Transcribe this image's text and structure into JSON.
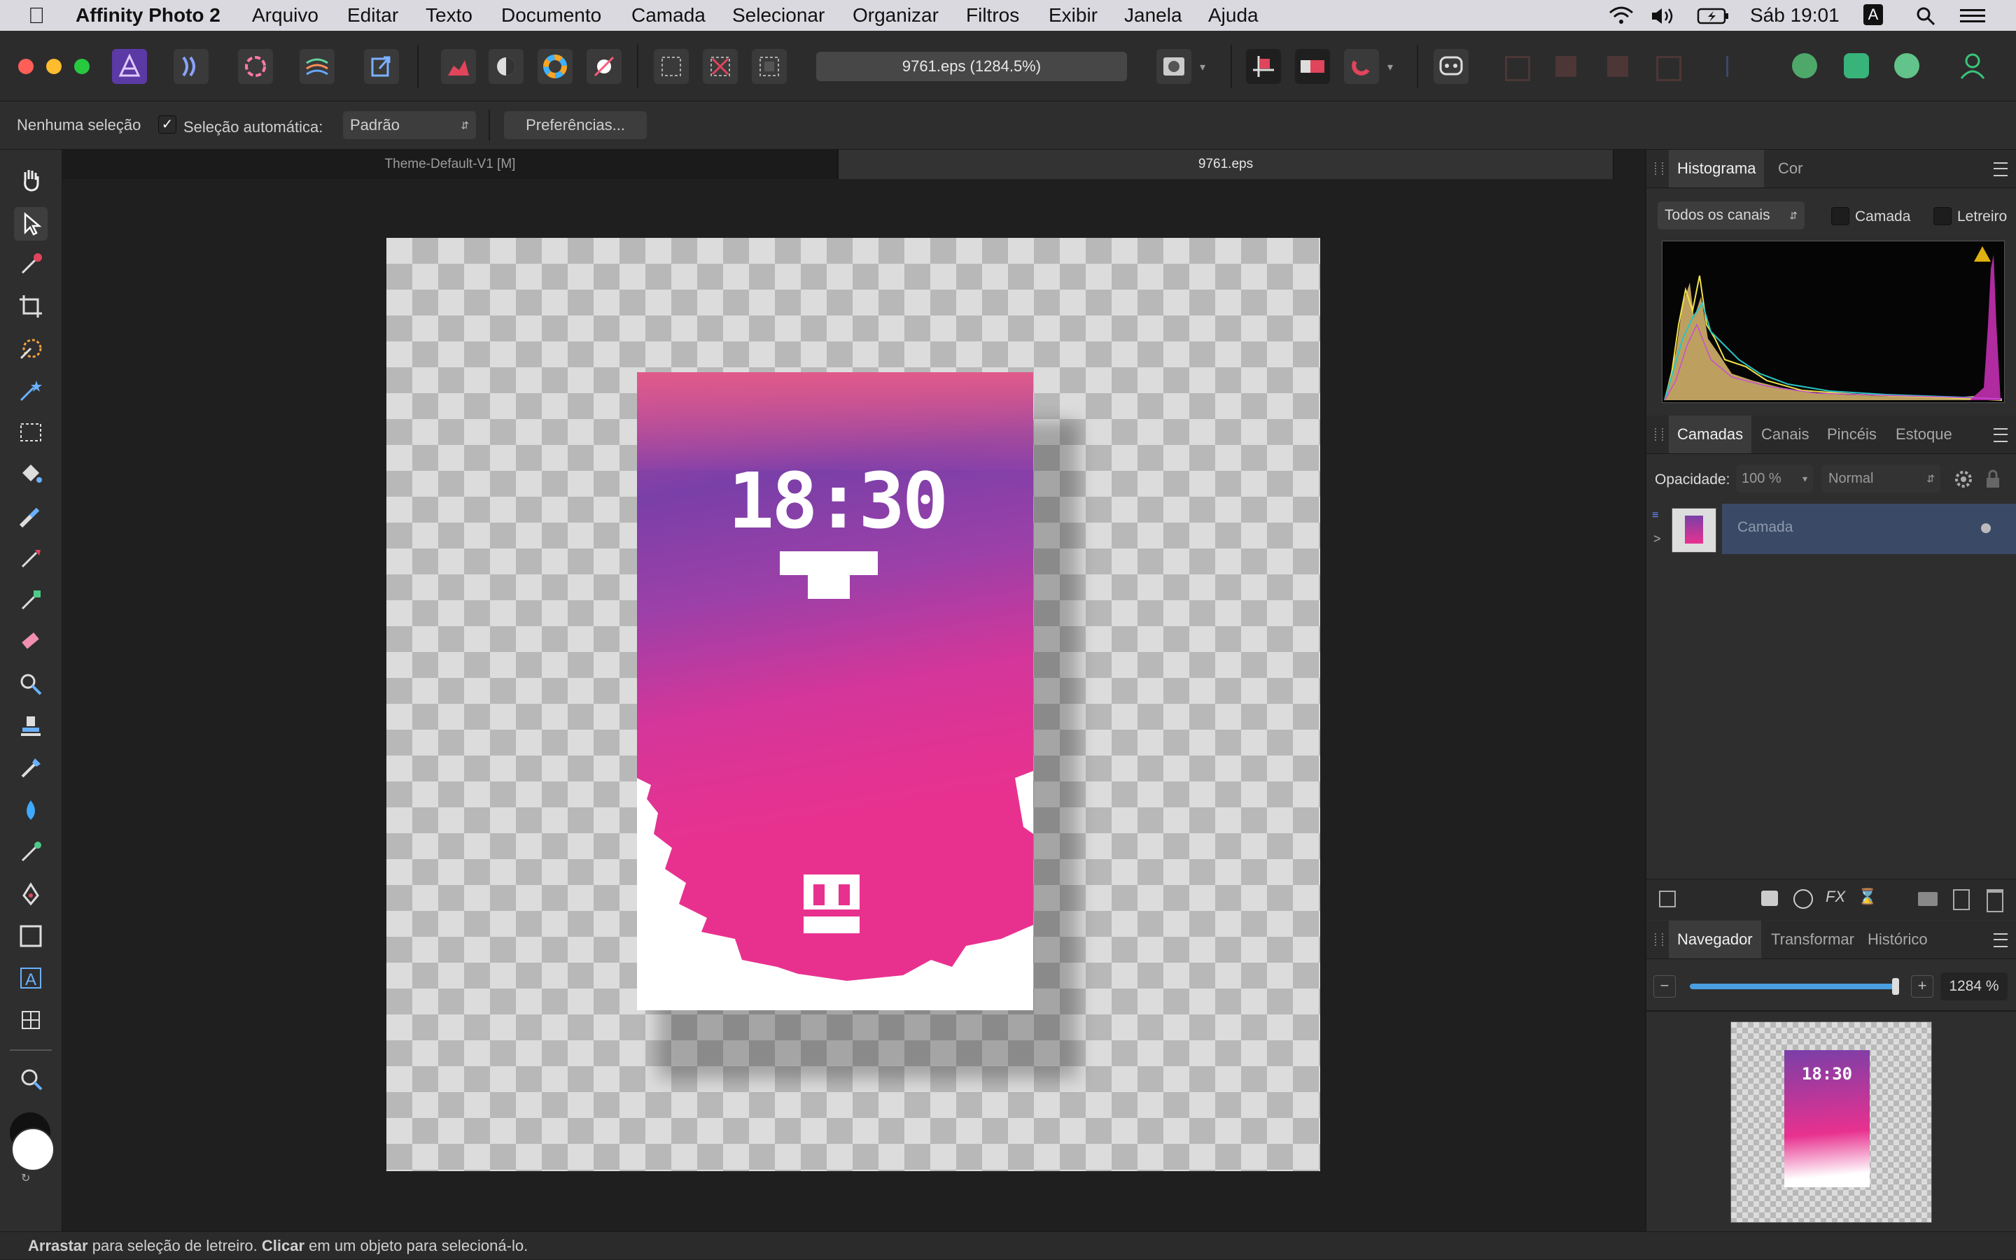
{
  "menubar": {
    "app_name": "Affinity Photo 2",
    "items": [
      "Arquivo",
      "Editar",
      "Texto",
      "Documento",
      "Camada",
      "Selecionar",
      "Organizar",
      "Filtros",
      "Exibir",
      "Janela",
      "Ajuda"
    ],
    "clock": "Sáb 19:01",
    "input_source": "A"
  },
  "toolbar": {
    "document_title": "9761.eps (1284.5%)"
  },
  "context": {
    "selection_status": "Nenhuma seleção",
    "auto_select_label": "Seleção automática:",
    "auto_select_checked": true,
    "auto_select_value": "Padrão",
    "preferences_button": "Preferências..."
  },
  "doc_tabs": [
    "Theme-Default-V1 [M]",
    "9761.eps"
  ],
  "canvas": {
    "artwork_time": "18:30"
  },
  "histogram_panel": {
    "tabs": [
      "Histograma",
      "Cor"
    ],
    "channel_select": "Todos os canais",
    "layer_checkbox": "Camada",
    "marquee_checkbox": "Letreiro"
  },
  "layers_panel": {
    "tabs": [
      "Camadas",
      "Canais",
      "Pincéis",
      "Estoque"
    ],
    "opacity_label": "Opacidade:",
    "opacity_value": "100 %",
    "blend_mode": "Normal",
    "layers": [
      {
        "name": "Camada",
        "visible": true
      }
    ]
  },
  "navigator_panel": {
    "tabs": [
      "Navegador",
      "Transformar",
      "Histórico"
    ],
    "zoom_value": "1284 %",
    "zoom_fraction": 0.98
  },
  "statusbar": {
    "drag_bold": "Arrastar",
    "drag_text": " para seleção de letreiro. ",
    "click_bold": "Clicar",
    "click_text": " em um objeto para selecioná-lo."
  },
  "colors": {
    "accent": "#8a5bd6",
    "pink": "#e8318f",
    "purple": "#7a3fa8",
    "selected_layer": "#3a4a66"
  }
}
